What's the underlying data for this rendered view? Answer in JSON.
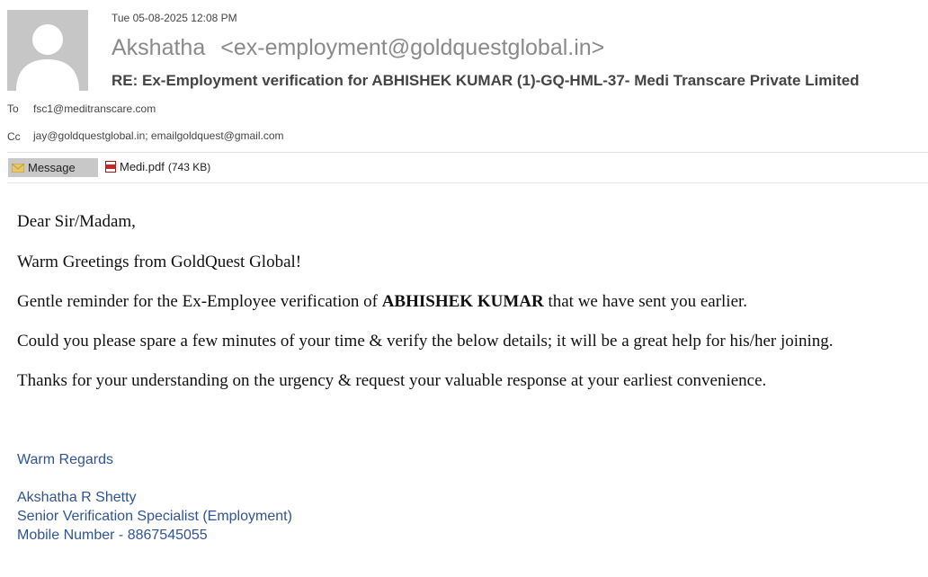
{
  "header": {
    "sent_date": "Tue 05-08-2025 12:08 PM",
    "sender_name": "Akshatha",
    "sender_email": "<ex-employment@goldquestglobal.in>",
    "subject": "RE: Ex-Employment verification for ABHISHEK KUMAR (1)-GQ-HML-37- Medi Transcare Private Limited",
    "to_label": "To",
    "to_value": "fsc1@meditranscare.com",
    "cc_label": "Cc",
    "cc_value": "jay@goldquestglobal.in; emailgoldquest@gmail.com",
    "avatar_icon": "default-person-icon"
  },
  "attachments_bar": {
    "message_tab_label": "Message",
    "message_icon": "envelope-icon",
    "attachment_name": "Medi.pdf",
    "attachment_size": "(743 KB)",
    "attachment_icon": "pdf-icon"
  },
  "body": {
    "greeting": "Dear Sir/Madam,",
    "line1": "Warm Greetings from GoldQuest Global!",
    "line2_before": "Gentle reminder for the Ex-Employee verification of ",
    "line2_bold": "ABHISHEK KUMAR",
    "line2_after": " that we have sent you earlier.",
    "line3": "Could you please spare a few minutes of your time & verify the below details; it will be a great help for his/her joining.",
    "line4": "Thanks for your understanding on the urgency & request your valuable response at your earliest convenience."
  },
  "signature": {
    "closing": "Warm Regards",
    "name": "Akshatha R Shetty",
    "title": "Senior Verification Specialist (Employment)",
    "mobile": "Mobile Number - 8867545055",
    "color": "#2f5496"
  }
}
